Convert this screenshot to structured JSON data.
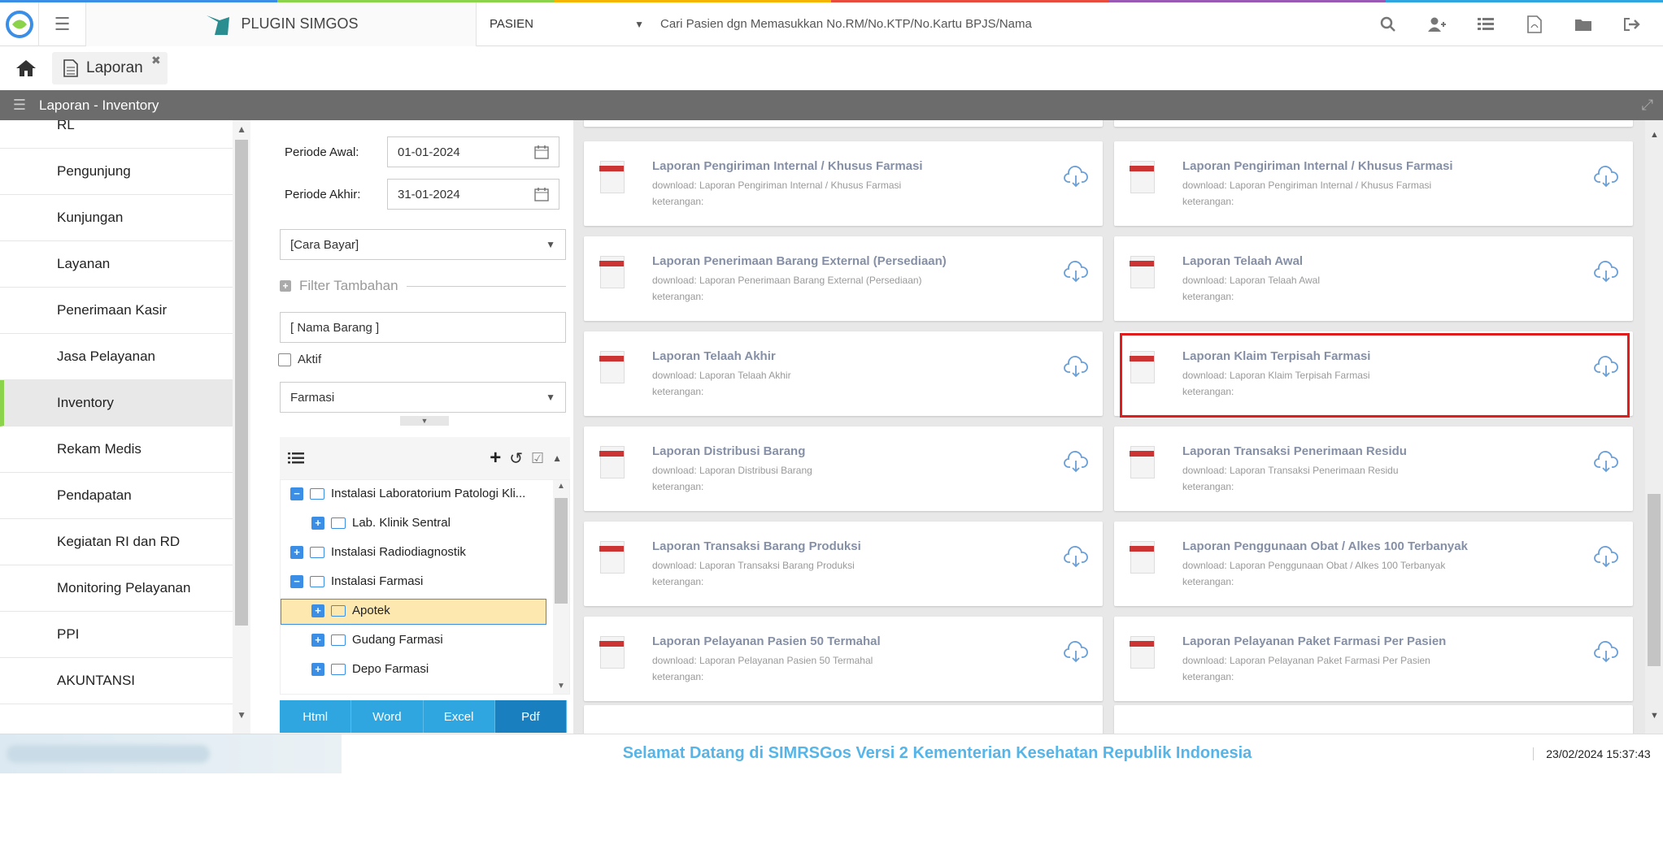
{
  "brand": {
    "name": "PLUGIN SIMGOS"
  },
  "search": {
    "mode": "PASIEN",
    "placeholder": "Cari Pasien dgn Memasukkan No.RM/No.KTP/No.Kartu BPJS/Nama"
  },
  "tab": {
    "label": "Laporan"
  },
  "title": "Laporan - Inventory",
  "sidebar": {
    "items": [
      {
        "label": "RL"
      },
      {
        "label": "Pengunjung"
      },
      {
        "label": "Kunjungan"
      },
      {
        "label": "Layanan"
      },
      {
        "label": "Penerimaan Kasir"
      },
      {
        "label": "Jasa Pelayanan"
      },
      {
        "label": "Inventory",
        "active": true
      },
      {
        "label": "Rekam Medis"
      },
      {
        "label": "Pendapatan"
      },
      {
        "label": "Kegiatan RI dan RD"
      },
      {
        "label": "Monitoring Pelayanan"
      },
      {
        "label": "PPI"
      },
      {
        "label": "AKUNTANSI"
      }
    ]
  },
  "filter": {
    "periode_awal_label": "Periode Awal:",
    "periode_awal_value": "01-01-2024",
    "periode_akhir_label": "Periode Akhir:",
    "periode_akhir_value": "31-01-2024",
    "cara_bayar": "[Cara Bayar]",
    "filter_tambahan": "Filter Tambahan",
    "nama_barang": "[ Nama Barang ]",
    "aktif_label": "Aktif",
    "jenis": "Farmasi"
  },
  "tree": {
    "nodes": [
      {
        "label": "Instalasi Laboratorium Patologi Kli...",
        "expanded": true,
        "level": 0
      },
      {
        "label": "Lab. Klinik Sentral",
        "expanded": false,
        "level": 1
      },
      {
        "label": "Instalasi Radiodiagnostik",
        "expanded": false,
        "level": 0
      },
      {
        "label": "Instalasi Farmasi",
        "expanded": true,
        "level": 0
      },
      {
        "label": "Apotek",
        "expanded": false,
        "level": 1,
        "selected": true
      },
      {
        "label": "Gudang Farmasi",
        "expanded": false,
        "level": 1
      },
      {
        "label": "Depo Farmasi",
        "expanded": false,
        "level": 1
      }
    ]
  },
  "export": {
    "html": "Html",
    "word": "Word",
    "excel": "Excel",
    "pdf": "Pdf"
  },
  "reports": [
    {
      "title": "Laporan Pengiriman Internal / Khusus Farmasi",
      "download": "download: Laporan Pengiriman Internal / Khusus Farmasi",
      "keterangan": "keterangan:"
    },
    {
      "title": "Laporan Pengiriman Internal / Khusus Farmasi",
      "download": "download: Laporan Pengiriman Internal / Khusus Farmasi",
      "keterangan": "keterangan:"
    },
    {
      "title": "Laporan Penerimaan Barang External (Persediaan)",
      "download": "download: Laporan Penerimaan Barang External (Persediaan)",
      "keterangan": "keterangan:"
    },
    {
      "title": "Laporan Telaah Awal",
      "download": "download: Laporan Telaah Awal",
      "keterangan": "keterangan:"
    },
    {
      "title": "Laporan Telaah Akhir",
      "download": "download: Laporan Telaah Akhir",
      "keterangan": "keterangan:"
    },
    {
      "title": "Laporan Klaim Terpisah Farmasi",
      "download": "download: Laporan Klaim Terpisah Farmasi",
      "keterangan": "keterangan:"
    },
    {
      "title": "Laporan Distribusi Barang",
      "download": "download: Laporan Distribusi Barang",
      "keterangan": "keterangan:"
    },
    {
      "title": "Laporan Transaksi Penerimaan Residu",
      "download": "download: Laporan Transaksi Penerimaan Residu",
      "keterangan": "keterangan:"
    },
    {
      "title": "Laporan Transaksi Barang Produksi",
      "download": "download: Laporan Transaksi Barang Produksi",
      "keterangan": "keterangan:"
    },
    {
      "title": "Laporan Penggunaan Obat / Alkes 100 Terbanyak",
      "download": "download: Laporan Penggunaan Obat / Alkes 100 Terbanyak",
      "keterangan": "keterangan:"
    },
    {
      "title": "Laporan Pelayanan Pasien 50 Termahal",
      "download": "download: Laporan Pelayanan Pasien 50 Termahal",
      "keterangan": "keterangan:"
    },
    {
      "title": "Laporan Pelayanan Paket Farmasi Per Pasien",
      "download": "download: Laporan Pelayanan Paket Farmasi Per Pasien",
      "keterangan": "keterangan:"
    }
  ],
  "footer": {
    "welcome": "Selamat Datang di SIMRSGos Versi 2 Kementerian Kesehatan Republik Indonesia",
    "datetime": "23/02/2024 15:37:43"
  },
  "colors": {
    "accent": "#2fa6e0",
    "highlight": "#e01c1c",
    "active_marker": "#8bd34a"
  }
}
